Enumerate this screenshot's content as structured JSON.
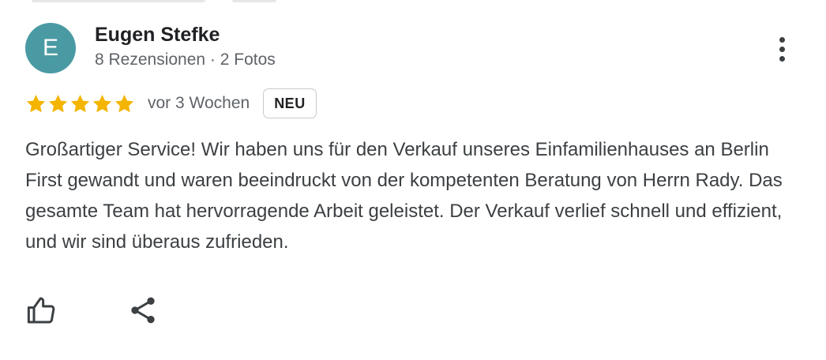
{
  "reviewer": {
    "initial": "E",
    "name": "Eugen Stefke",
    "meta": "8 Rezensionen · 2 Fotos",
    "avatar_color": "#4a9aa3"
  },
  "review": {
    "rating": 5,
    "rating_max": 5,
    "date": "vor 3 Wochen",
    "badge": "NEU",
    "star_color": "#f4b400",
    "text": "Großartiger Service! Wir haben uns für den Verkauf unseres Einfamilienhauses an Berlin First gewandt und waren beeindruckt von der kompetenten Beratung von Herrn Rady. Das gesamte Team hat hervorragende Arbeit geleistet. Der Verkauf verlief schnell und effizient, und wir sind überaus zufrieden."
  },
  "actions": {
    "like_icon": "thumb-up-icon",
    "share_icon": "share-icon",
    "more_icon": "more-vert-icon"
  }
}
